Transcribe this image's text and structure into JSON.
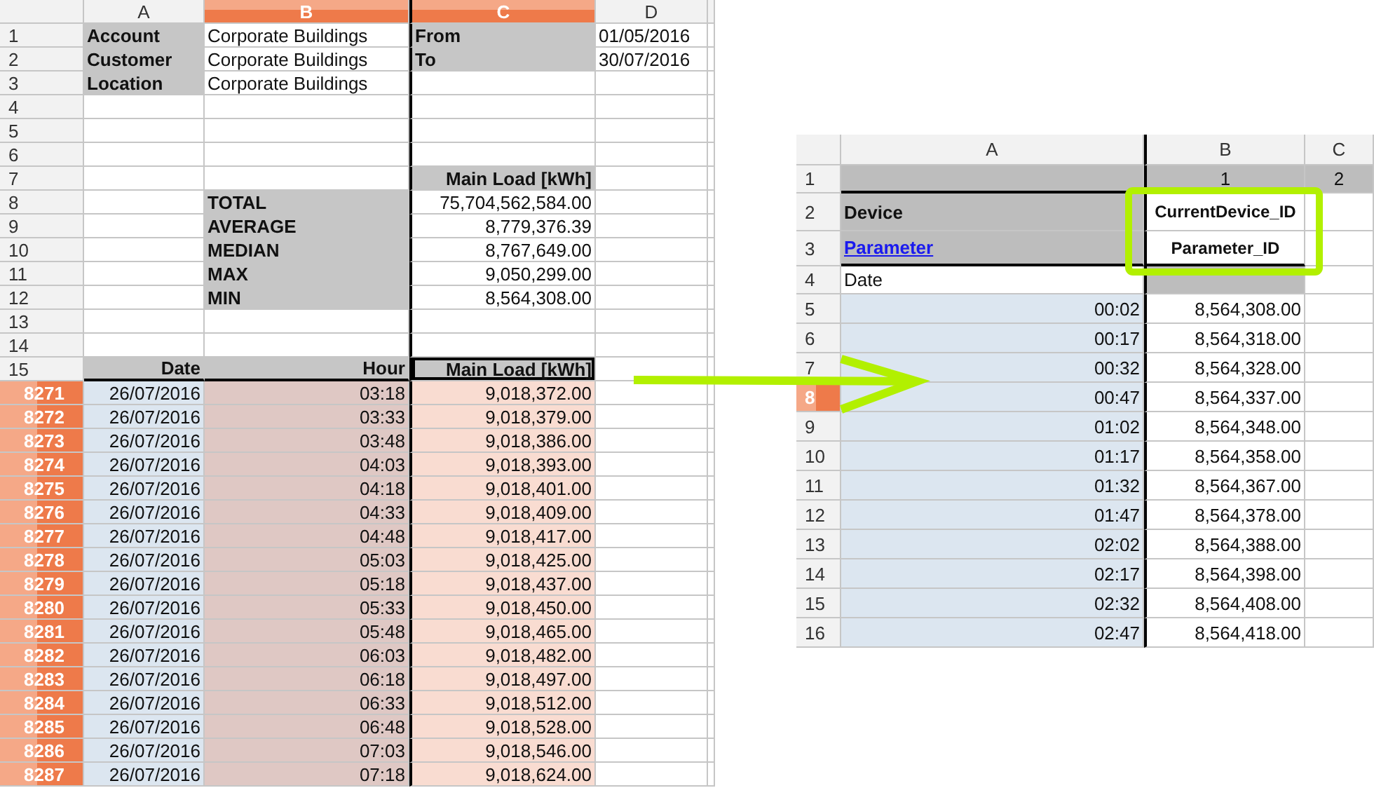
{
  "left_sheet": {
    "columns": [
      {
        "label": "A",
        "selected": false
      },
      {
        "label": "B",
        "selected": true
      },
      {
        "label": "C",
        "selected": true
      },
      {
        "label": "D",
        "selected": false
      }
    ],
    "rows": [
      {
        "header": "1",
        "selected": false,
        "cells": [
          {
            "kind": "label",
            "text": "Account"
          },
          {
            "kind": "text",
            "text": "Corporate Buildings"
          },
          {
            "kind": "label",
            "text": "From"
          },
          {
            "kind": "text",
            "text": "01/05/2016"
          }
        ]
      },
      {
        "header": "2",
        "selected": false,
        "cells": [
          {
            "kind": "label",
            "text": "Customer"
          },
          {
            "kind": "text",
            "text": "Corporate Buildings"
          },
          {
            "kind": "label",
            "text": "To"
          },
          {
            "kind": "text",
            "text": "30/07/2016"
          }
        ]
      },
      {
        "header": "3",
        "selected": false,
        "cells": [
          {
            "kind": "label",
            "text": "Location"
          },
          {
            "kind": "text",
            "text": "Corporate Buildings"
          }
        ]
      },
      {
        "header": "4",
        "selected": false,
        "cells": []
      },
      {
        "header": "5",
        "selected": false,
        "cells": []
      },
      {
        "header": "6",
        "selected": false,
        "cells": []
      },
      {
        "header": "7",
        "selected": false,
        "cells": [
          {
            "kind": "blank"
          },
          {
            "kind": "blank"
          },
          {
            "kind": "heading",
            "text": "Main Load [kWh]"
          }
        ]
      },
      {
        "header": "8",
        "selected": false,
        "cells": [
          {
            "kind": "blank"
          },
          {
            "kind": "label",
            "text": "TOTAL"
          },
          {
            "kind": "value",
            "text": "75,704,562,584.00"
          }
        ]
      },
      {
        "header": "9",
        "selected": false,
        "cells": [
          {
            "kind": "blank"
          },
          {
            "kind": "label",
            "text": "AVERAGE"
          },
          {
            "kind": "value",
            "text": "8,779,376.39"
          }
        ]
      },
      {
        "header": "10",
        "selected": false,
        "cells": [
          {
            "kind": "blank"
          },
          {
            "kind": "label",
            "text": "MEDIAN"
          },
          {
            "kind": "value",
            "text": "8,767,649.00"
          }
        ]
      },
      {
        "header": "11",
        "selected": false,
        "cells": [
          {
            "kind": "blank"
          },
          {
            "kind": "label",
            "text": "MAX"
          },
          {
            "kind": "value",
            "text": "9,050,299.00"
          }
        ]
      },
      {
        "header": "12",
        "selected": false,
        "cells": [
          {
            "kind": "blank"
          },
          {
            "kind": "label",
            "text": "MIN"
          },
          {
            "kind": "value",
            "text": "8,564,308.00"
          }
        ]
      },
      {
        "header": "13",
        "selected": false,
        "cells": []
      },
      {
        "header": "14",
        "selected": false,
        "cells": []
      },
      {
        "header": "15",
        "selected": false,
        "cells": [
          {
            "kind": "heading",
            "text": "Date"
          },
          {
            "kind": "heading",
            "text": "Hour"
          },
          {
            "kind": "cursor",
            "text": "Main Load [kWh]"
          }
        ]
      },
      {
        "header": "8271",
        "selected": true,
        "cells": [
          {
            "kind": "date",
            "text": "26/07/2016"
          },
          {
            "kind": "hour",
            "text": "03:18"
          },
          {
            "kind": "load",
            "text": "9,018,372.00"
          }
        ]
      },
      {
        "header": "8272",
        "selected": true,
        "cells": [
          {
            "kind": "date",
            "text": "26/07/2016"
          },
          {
            "kind": "hour",
            "text": "03:33"
          },
          {
            "kind": "load",
            "text": "9,018,379.00"
          }
        ]
      },
      {
        "header": "8273",
        "selected": true,
        "cells": [
          {
            "kind": "date",
            "text": "26/07/2016"
          },
          {
            "kind": "hour",
            "text": "03:48"
          },
          {
            "kind": "load",
            "text": "9,018,386.00"
          }
        ]
      },
      {
        "header": "8274",
        "selected": true,
        "cells": [
          {
            "kind": "date",
            "text": "26/07/2016"
          },
          {
            "kind": "hour",
            "text": "04:03"
          },
          {
            "kind": "load",
            "text": "9,018,393.00"
          }
        ]
      },
      {
        "header": "8275",
        "selected": true,
        "cells": [
          {
            "kind": "date",
            "text": "26/07/2016"
          },
          {
            "kind": "hour",
            "text": "04:18"
          },
          {
            "kind": "load",
            "text": "9,018,401.00"
          }
        ]
      },
      {
        "header": "8276",
        "selected": true,
        "cells": [
          {
            "kind": "date",
            "text": "26/07/2016"
          },
          {
            "kind": "hour",
            "text": "04:33"
          },
          {
            "kind": "load",
            "text": "9,018,409.00"
          }
        ]
      },
      {
        "header": "8277",
        "selected": true,
        "cells": [
          {
            "kind": "date",
            "text": "26/07/2016"
          },
          {
            "kind": "hour",
            "text": "04:48"
          },
          {
            "kind": "load",
            "text": "9,018,417.00"
          }
        ]
      },
      {
        "header": "8278",
        "selected": true,
        "cells": [
          {
            "kind": "date",
            "text": "26/07/2016"
          },
          {
            "kind": "hour",
            "text": "05:03"
          },
          {
            "kind": "load",
            "text": "9,018,425.00"
          }
        ]
      },
      {
        "header": "8279",
        "selected": true,
        "cells": [
          {
            "kind": "date",
            "text": "26/07/2016"
          },
          {
            "kind": "hour",
            "text": "05:18"
          },
          {
            "kind": "load",
            "text": "9,018,437.00"
          }
        ]
      },
      {
        "header": "8280",
        "selected": true,
        "cells": [
          {
            "kind": "date",
            "text": "26/07/2016"
          },
          {
            "kind": "hour",
            "text": "05:33"
          },
          {
            "kind": "load",
            "text": "9,018,450.00"
          }
        ]
      },
      {
        "header": "8281",
        "selected": true,
        "cells": [
          {
            "kind": "date",
            "text": "26/07/2016"
          },
          {
            "kind": "hour",
            "text": "05:48"
          },
          {
            "kind": "load",
            "text": "9,018,465.00"
          }
        ]
      },
      {
        "header": "8282",
        "selected": true,
        "cells": [
          {
            "kind": "date",
            "text": "26/07/2016"
          },
          {
            "kind": "hour",
            "text": "06:03"
          },
          {
            "kind": "load",
            "text": "9,018,482.00"
          }
        ]
      },
      {
        "header": "8283",
        "selected": true,
        "cells": [
          {
            "kind": "date",
            "text": "26/07/2016"
          },
          {
            "kind": "hour",
            "text": "06:18"
          },
          {
            "kind": "load",
            "text": "9,018,497.00"
          }
        ]
      },
      {
        "header": "8284",
        "selected": true,
        "cells": [
          {
            "kind": "date",
            "text": "26/07/2016"
          },
          {
            "kind": "hour",
            "text": "06:33"
          },
          {
            "kind": "load",
            "text": "9,018,512.00"
          }
        ]
      },
      {
        "header": "8285",
        "selected": true,
        "cells": [
          {
            "kind": "date",
            "text": "26/07/2016"
          },
          {
            "kind": "hour",
            "text": "06:48"
          },
          {
            "kind": "load",
            "text": "9,018,528.00"
          }
        ]
      },
      {
        "header": "8286",
        "selected": true,
        "cells": [
          {
            "kind": "date",
            "text": "26/07/2016"
          },
          {
            "kind": "hour",
            "text": "07:03"
          },
          {
            "kind": "load",
            "text": "9,018,546.00"
          }
        ]
      },
      {
        "header": "8287",
        "selected": true,
        "cells": [
          {
            "kind": "date",
            "text": "26/07/2016"
          },
          {
            "kind": "hour",
            "text": "07:18"
          },
          {
            "kind": "load",
            "text": "9,018,624.00"
          }
        ]
      }
    ]
  },
  "right_sheet": {
    "columns": [
      {
        "label": "A",
        "selected": false
      },
      {
        "label": "B",
        "selected": false
      },
      {
        "label": "C",
        "selected": false
      }
    ],
    "rows": [
      {
        "header": "1",
        "selected": false,
        "cells": [
          {
            "kind": "shade"
          },
          {
            "kind": "index",
            "text": "1"
          },
          {
            "kind": "index",
            "text": "2"
          }
        ]
      },
      {
        "header": "2",
        "selected": false,
        "cells": [
          {
            "kind": "label",
            "text": "Device"
          },
          {
            "kind": "id",
            "text": "CurrentDevice_ID"
          }
        ]
      },
      {
        "header": "3",
        "selected": false,
        "cells": [
          {
            "kind": "link",
            "text": "Parameter"
          },
          {
            "kind": "id",
            "text": "Parameter_ID"
          }
        ]
      },
      {
        "header": "4",
        "selected": false,
        "cells": [
          {
            "kind": "text",
            "text": "Date"
          },
          {
            "kind": "shade"
          }
        ]
      },
      {
        "header": "5",
        "selected": false,
        "cells": [
          {
            "kind": "date",
            "text": "00:02"
          },
          {
            "kind": "value",
            "text": "8,564,308.00"
          }
        ]
      },
      {
        "header": "6",
        "selected": false,
        "cells": [
          {
            "kind": "date",
            "text": "00:17"
          },
          {
            "kind": "value",
            "text": "8,564,318.00"
          }
        ]
      },
      {
        "header": "7",
        "selected": false,
        "cells": [
          {
            "kind": "date",
            "text": "00:32"
          },
          {
            "kind": "value",
            "text": "8,564,328.00"
          }
        ]
      },
      {
        "header": "8",
        "selected": true,
        "cells": [
          {
            "kind": "date",
            "text": "00:47"
          },
          {
            "kind": "value",
            "text": "8,564,337.00"
          }
        ]
      },
      {
        "header": "9",
        "selected": false,
        "cells": [
          {
            "kind": "date",
            "text": "01:02"
          },
          {
            "kind": "value",
            "text": "8,564,348.00"
          }
        ]
      },
      {
        "header": "10",
        "selected": false,
        "cells": [
          {
            "kind": "date",
            "text": "01:17"
          },
          {
            "kind": "value",
            "text": "8,564,358.00"
          }
        ]
      },
      {
        "header": "11",
        "selected": false,
        "cells": [
          {
            "kind": "date",
            "text": "01:32"
          },
          {
            "kind": "value",
            "text": "8,564,367.00"
          }
        ]
      },
      {
        "header": "12",
        "selected": false,
        "cells": [
          {
            "kind": "date",
            "text": "01:47"
          },
          {
            "kind": "value",
            "text": "8,564,378.00"
          }
        ]
      },
      {
        "header": "13",
        "selected": false,
        "cells": [
          {
            "kind": "date",
            "text": "02:02"
          },
          {
            "kind": "value",
            "text": "8,564,388.00"
          }
        ]
      },
      {
        "header": "14",
        "selected": false,
        "cells": [
          {
            "kind": "date",
            "text": "02:17"
          },
          {
            "kind": "value",
            "text": "8,564,398.00"
          }
        ]
      },
      {
        "header": "15",
        "selected": false,
        "cells": [
          {
            "kind": "date",
            "text": "02:32"
          },
          {
            "kind": "value",
            "text": "8,564,408.00"
          }
        ]
      },
      {
        "header": "16",
        "selected": false,
        "cells": [
          {
            "kind": "date",
            "text": "02:47"
          },
          {
            "kind": "value",
            "text": "8,564,418.00"
          }
        ]
      }
    ]
  }
}
